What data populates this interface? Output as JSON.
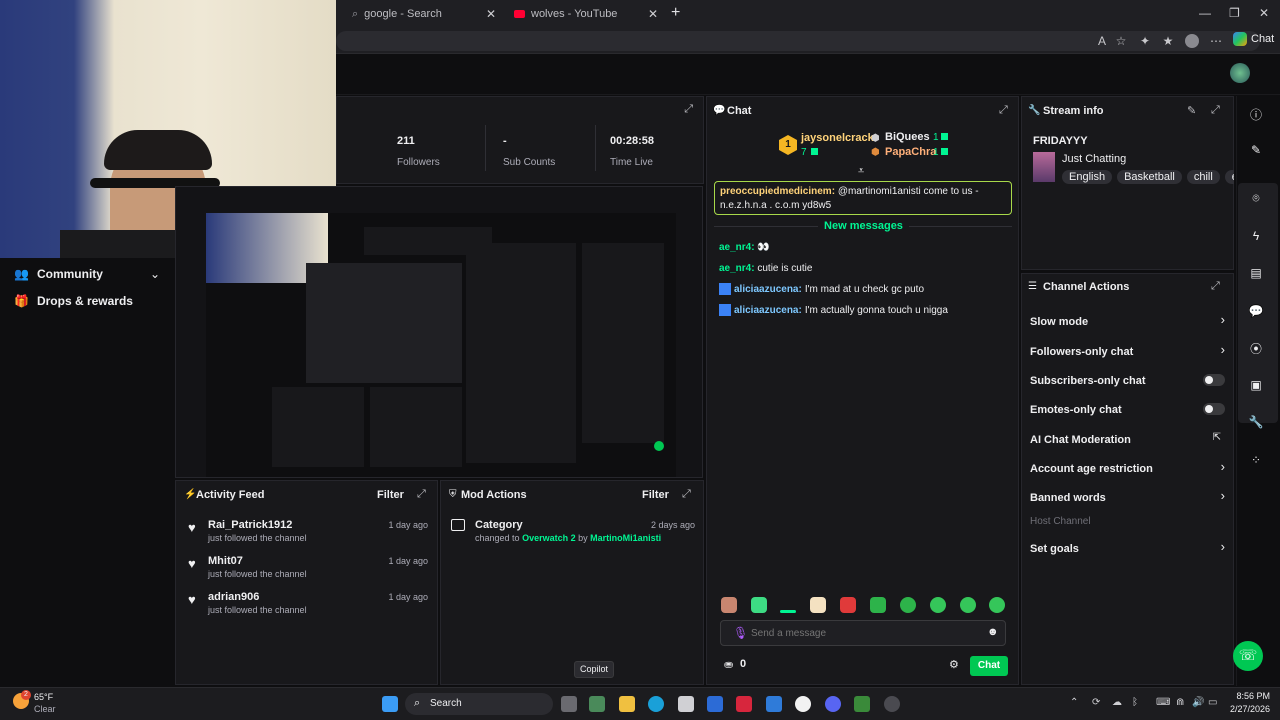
{
  "browser": {
    "tabs": [
      {
        "label": "google - Search"
      },
      {
        "label": "wolves - YouTube"
      }
    ],
    "new_tab": "+",
    "copilot_label": "Chat"
  },
  "sidebar": {
    "items": [
      {
        "label": "Community"
      },
      {
        "label": "Drops & rewards"
      }
    ]
  },
  "stats": {
    "followers_value": "211",
    "followers_label": "Followers",
    "subs_value": "-",
    "subs_label": "Sub Counts",
    "time_value": "00:28:58",
    "time_label": "Time Live"
  },
  "activity": {
    "title": "Activity Feed",
    "filter": "Filter",
    "items": [
      {
        "name": "Rai_Patrick1912",
        "desc": "just followed the channel",
        "time": "1 day ago"
      },
      {
        "name": "Mhit07",
        "desc": "just followed the channel",
        "time": "1 day ago"
      },
      {
        "name": "adrian906",
        "desc": "just followed the channel",
        "time": "1 day ago"
      }
    ]
  },
  "mod_actions": {
    "title": "Mod Actions",
    "filter": "Filter",
    "item": {
      "title": "Category",
      "time": "2 days ago",
      "changed_to": "changed to",
      "game": "Overwatch 2",
      "by": "by",
      "user": "MartinoMi1anisti"
    }
  },
  "chat": {
    "title": "Chat",
    "leader_rank": "1",
    "leader_name": "jaysonelcrack",
    "leader_count": "7",
    "second_name": "BiQuees",
    "second_count": "1",
    "third_name": "PapaChra",
    "third_count": "1",
    "pinned_user": "preoccupiedmedicinem:",
    "pinned_text": "@martinomi1anisti come to us - n.e.z.h.n.a . c.o.m yd8w5",
    "new_messages": "New messages",
    "messages": [
      {
        "user": "ae_nr4:",
        "text": "👀"
      },
      {
        "user": "ae_nr4:",
        "text": "cutie is cutie"
      },
      {
        "user": "aliciaazucena:",
        "text": "I'm mad at u check gc puto"
      },
      {
        "user": "aliciaazucena:",
        "text": "I'm actually gonna touch u nigga"
      }
    ],
    "input_placeholder": "Send a message",
    "points": "0",
    "send_label": "Chat"
  },
  "stream_info": {
    "title": "Stream info",
    "stream_title": "FRIDAYYY",
    "category": "Just Chatting",
    "tags": [
      "English",
      "Basketball",
      "chill",
      "en"
    ]
  },
  "channel_actions": {
    "title": "Channel Actions",
    "items": [
      {
        "label": "Slow mode",
        "kind": "arrow"
      },
      {
        "label": "Followers-only chat",
        "kind": "arrow"
      },
      {
        "label": "Subscribers-only chat",
        "kind": "toggle"
      },
      {
        "label": "Emotes-only chat",
        "kind": "toggle"
      },
      {
        "label": "AI Chat Moderation",
        "kind": "external"
      },
      {
        "label": "Account age restriction",
        "kind": "arrow"
      },
      {
        "label": "Banned words",
        "kind": "arrow"
      },
      {
        "label": "Host Channel",
        "kind": "disabled"
      },
      {
        "label": "Set goals",
        "kind": "arrow"
      }
    ]
  },
  "tooltip": "Copilot",
  "taskbar": {
    "weather_temp": "65°F",
    "weather_desc": "Clear",
    "weather_badge": "2",
    "search": "Search",
    "time": "8:56 PM",
    "date": "2/27/2026"
  },
  "colors": {
    "accent_green": "#00f593",
    "chat_send": "#00c853",
    "panel": "#18181b",
    "background": "#0e0e10",
    "pinned_border": "#a8d94a"
  }
}
